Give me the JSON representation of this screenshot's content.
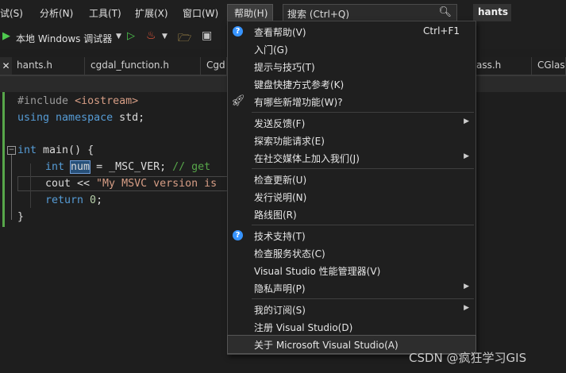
{
  "menubar": {
    "items": [
      "试(S)",
      "分析(N)",
      "工具(T)",
      "扩展(X)",
      "窗口(W)",
      "帮助(H)"
    ],
    "search_placeholder": "搜索 (Ctrl+Q)",
    "solution": "hants"
  },
  "toolbar": {
    "run_target": "本地 Windows 调试器"
  },
  "tabs": [
    "hants.h",
    "cgdal_function.h",
    "Cgd",
    "ass.h",
    "CGlass"
  ],
  "code": {
    "l1_pp": "#include ",
    "l1_inc": "<iostream>",
    "l2_kw1": "using",
    "l2_kw2": "namespace",
    "l2_rest": " std;",
    "l4_kw": "int",
    "l4_rest": " main() {",
    "l5_kw": "int",
    "l5_var": "num",
    "l5_rest": " = _MSC_VER; ",
    "l5_cm": "// get",
    "l6_a": "cout << ",
    "l6_str": "\"My MSVC version is",
    "l7_kw": "return",
    "l7_num": " 0",
    "l7_rest": ";",
    "l8": "}"
  },
  "help_menu": {
    "items": [
      {
        "label": "查看帮助(V)",
        "shortcut": "Ctrl+F1"
      },
      {
        "label": "入门(G)"
      },
      {
        "label": "提示与技巧(T)"
      },
      {
        "label": "键盘快捷方式参考(K)"
      },
      {
        "label": "有哪些新增功能(W)?"
      },
      {
        "label": "发送反馈(F)"
      },
      {
        "label": "探索功能请求(E)"
      },
      {
        "label": "在社交媒体上加入我们(J)"
      },
      {
        "label": "检查更新(U)"
      },
      {
        "label": "发行说明(N)"
      },
      {
        "label": "路线图(R)"
      },
      {
        "label": "技术支持(T)"
      },
      {
        "label": "检查服务状态(C)"
      },
      {
        "label": "Visual Studio 性能管理器(V)"
      },
      {
        "label": "隐私声明(P)"
      },
      {
        "label": "我的订阅(S)"
      },
      {
        "label": "注册 Visual Studio(D)"
      },
      {
        "label": "关于 Microsoft Visual Studio(A)"
      }
    ]
  },
  "watermark": "CSDN @疯狂学习GIS",
  "icons": {
    "help": "question-circle-icon",
    "whats_new": "rocket-icon",
    "search": "magnifier-icon"
  }
}
